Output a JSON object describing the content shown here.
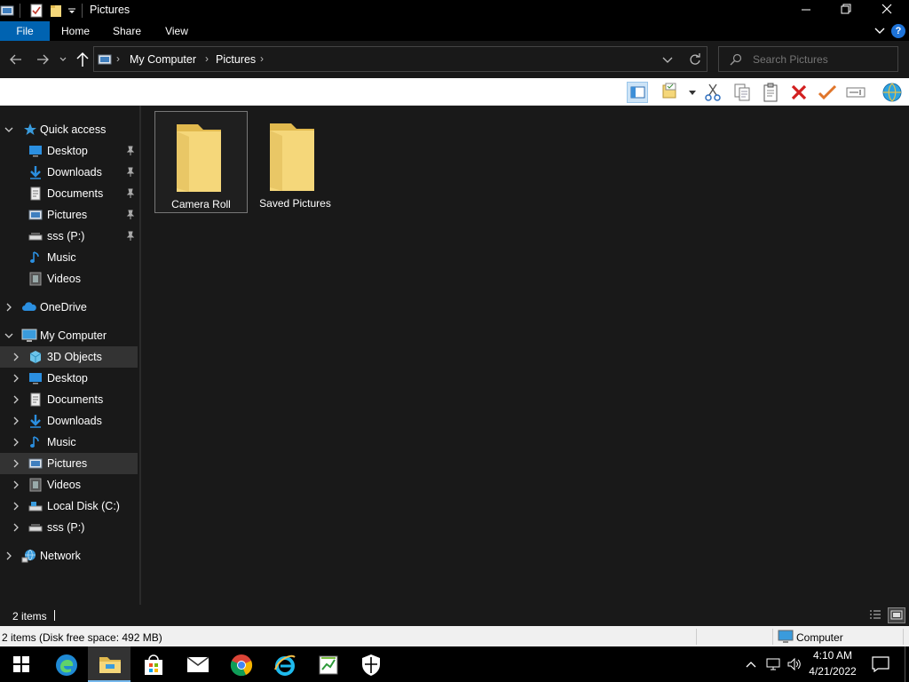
{
  "window": {
    "title": "Pictures"
  },
  "ribbon": {
    "tabs": [
      "File",
      "Home",
      "Share",
      "View"
    ]
  },
  "address": {
    "crumbs": [
      "My Computer",
      "Pictures"
    ]
  },
  "search": {
    "placeholder": "Search Pictures"
  },
  "nav": {
    "quick_access": "Quick access",
    "quick_items": [
      "Desktop",
      "Downloads",
      "Documents",
      "Pictures",
      "sss (P:)",
      "Music",
      "Videos"
    ],
    "onedrive": "OneDrive",
    "computer": "My Computer",
    "computer_items": [
      "3D Objects",
      "Desktop",
      "Documents",
      "Downloads",
      "Music",
      "Pictures",
      "Videos",
      "Local Disk (C:)",
      "sss (P:)"
    ],
    "network": "Network"
  },
  "content": {
    "folders": [
      "Camera Roll",
      "Saved Pictures"
    ]
  },
  "status": {
    "items": "2 items"
  },
  "infobar": {
    "text": "2 items (Disk free space: 492 MB)",
    "location": "Computer"
  },
  "clock": {
    "time": "4:10 AM",
    "date": "4/21/2022"
  },
  "colors": {
    "accent": "#0063b1",
    "folder": "#f5d77a",
    "folder_dark": "#e1b94e"
  }
}
